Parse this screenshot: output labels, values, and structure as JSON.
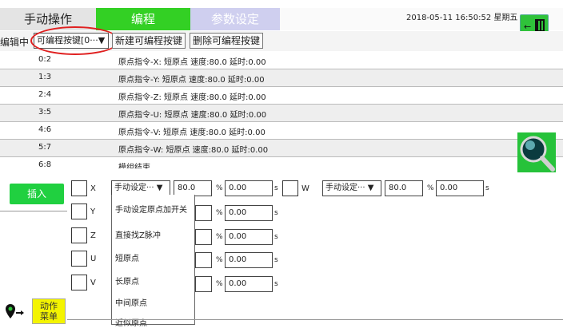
{
  "tabs": {
    "manual": "手动操作",
    "program": "编程",
    "params": "参数设定"
  },
  "header": {
    "datetime": "2018-05-11  16:50:52  星期五"
  },
  "toolbar": {
    "editing_label": "编辑中",
    "program_select": "可编程按键[0···▼",
    "new_button": "新建可编程按键",
    "delete_button": "删除可编程按键"
  },
  "rows": [
    {
      "idx": "0:2",
      "text": "原点指令-X: 短原点 速度:80.0 延时:0.00"
    },
    {
      "idx": "1:3",
      "text": "原点指令-Y: 短原点 速度:80.0 延时:0.00"
    },
    {
      "idx": "2:4",
      "text": "原点指令-Z: 短原点 速度:80.0 延时:0.00"
    },
    {
      "idx": "3:5",
      "text": "原点指令-U: 短原点 速度:80.0 延时:0.00"
    },
    {
      "idx": "4:6",
      "text": "原点指令-V: 短原点 速度:80.0 延时:0.00"
    },
    {
      "idx": "5:7",
      "text": "原点指令-W: 短原点 速度:80.0 延时:0.00"
    },
    {
      "idx": "6:8",
      "text": "模组结束"
    }
  ],
  "editor": {
    "insert_button": "插入",
    "axes": [
      "X",
      "Y",
      "Z",
      "U",
      "V",
      "W"
    ],
    "mode_select": "手动设定··· ▼",
    "speed": "80.0",
    "percent": "%",
    "delay": "0.00",
    "seconds": "s",
    "menu_button_line1": "动作",
    "menu_button_line2": "菜单",
    "dropdown_options": [
      "手动设定原点加开关",
      "直接找Z脉冲",
      "短原点",
      "长原点",
      "中间原点",
      "近似原点"
    ]
  },
  "colors": {
    "program_tab": "#33d024",
    "params_tab": "#cfcfef",
    "insert": "#20d040",
    "menu": "#f4f400",
    "highlight": "#e02020"
  }
}
